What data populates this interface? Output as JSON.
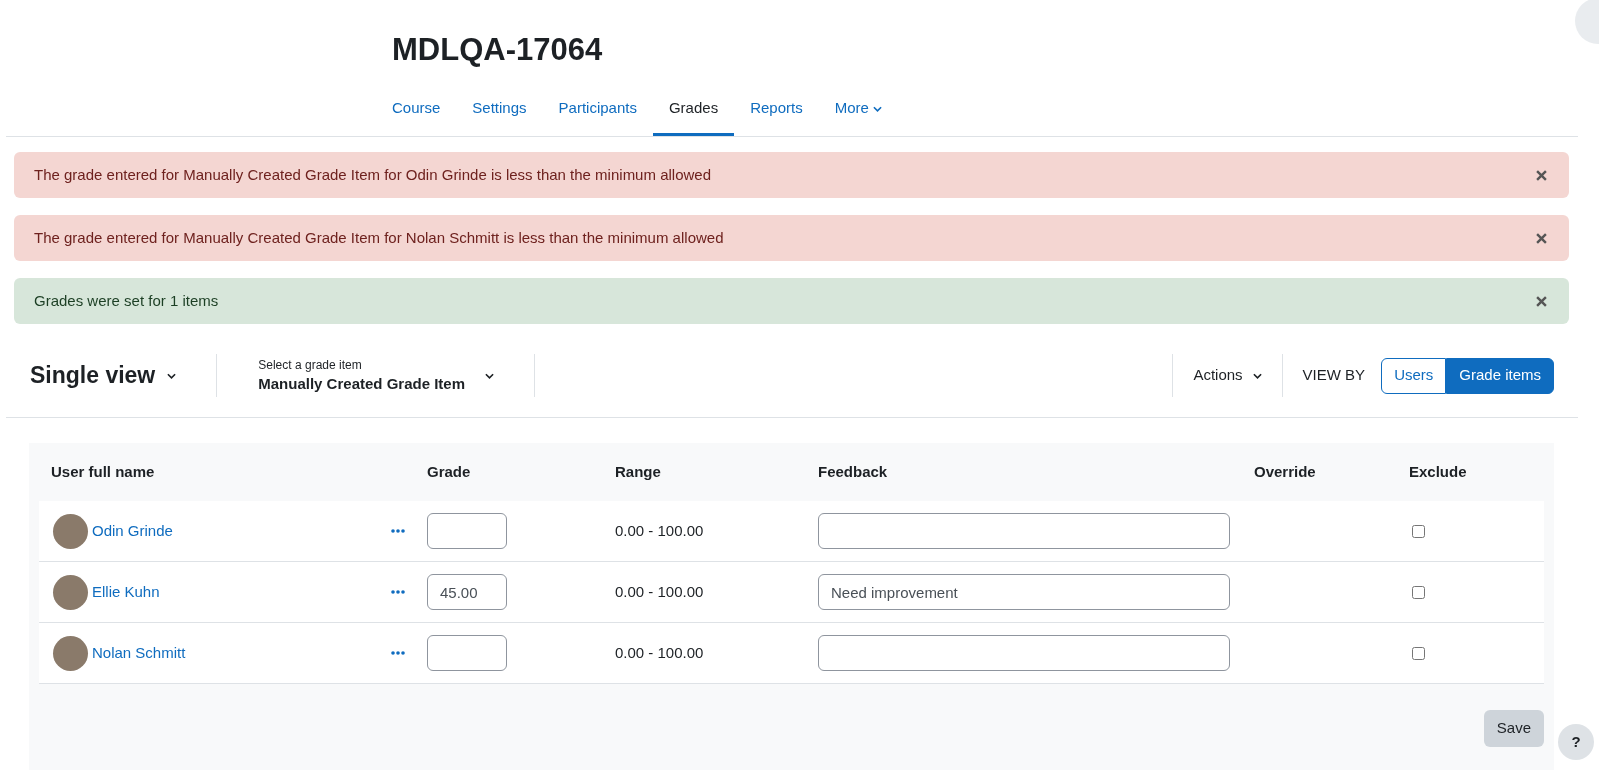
{
  "page_title": "MDLQA-17064",
  "nav_tabs": [
    {
      "label": "Course",
      "selected": false,
      "kind": "link"
    },
    {
      "label": "Settings",
      "selected": false,
      "kind": "link"
    },
    {
      "label": "Participants",
      "selected": false,
      "kind": "link"
    },
    {
      "label": "Grades",
      "selected": true,
      "kind": "link"
    },
    {
      "label": "Reports",
      "selected": false,
      "kind": "link"
    },
    {
      "label": "More",
      "selected": false,
      "kind": "menu"
    }
  ],
  "alerts": [
    {
      "kind": "error",
      "text": "The grade entered for Manually Created Grade Item for Odin Grinde is less than the minimum allowed"
    },
    {
      "kind": "error",
      "text": "The grade entered for Manually Created Grade Item for Nolan Schmitt is less than the minimum allowed"
    },
    {
      "kind": "success",
      "text": "Grades were set for 1 items"
    }
  ],
  "toolbar": {
    "report_selector": "Single view",
    "grade_item_selector": {
      "label": "Select a grade item",
      "value": "Manually Created Grade Item"
    },
    "actions": "Actions",
    "view_by": {
      "label": "VIEW BY",
      "options": [
        {
          "label": "Users",
          "selected": false
        },
        {
          "label": "Grade items",
          "selected": true
        }
      ]
    }
  },
  "table": {
    "columns": [
      "User full name",
      "",
      "Grade",
      "Range",
      "Feedback",
      "Override",
      "Exclude"
    ],
    "rows": [
      {
        "name": "Odin Grinde",
        "range": "0.00 - 100.00",
        "exclude": false
      },
      {
        "name": "Ellie Kuhn",
        "grade": "45.00",
        "range": "0.00 - 100.00",
        "feedback": "Need improvement",
        "exclude": false
      },
      {
        "name": "Nolan Schmitt",
        "range": "0.00 - 100.00",
        "exclude": false
      }
    ]
  },
  "save_button": "Save",
  "help_button": "?"
}
